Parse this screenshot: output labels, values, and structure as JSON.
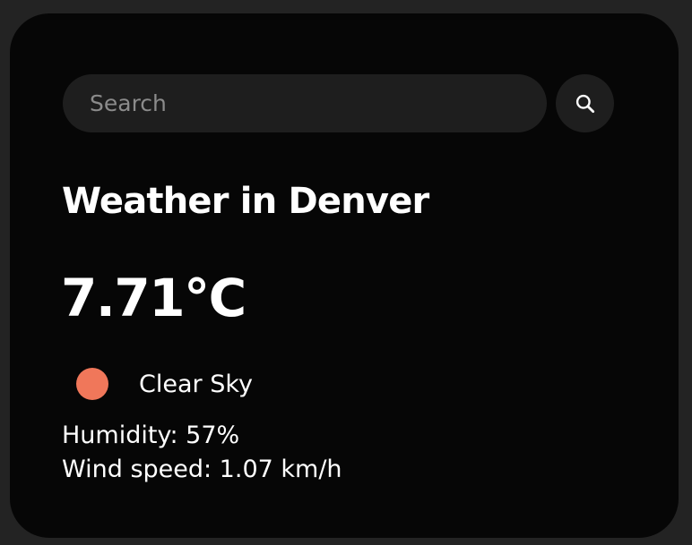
{
  "search": {
    "placeholder": "Search",
    "value": "",
    "button_icon": "search-icon"
  },
  "weather": {
    "title": "Weather in Denver",
    "temperature": "7.71°C",
    "condition": "Clear Sky",
    "condition_icon": "sun-circle-icon",
    "condition_color": "#f0775a",
    "humidity": "Humidity: 57%",
    "wind_speed": "Wind speed: 1.07 km/h"
  },
  "colors": {
    "page_background": "#232323",
    "card_background": "#060606",
    "input_background": "#1e1e1e",
    "text": "#ffffff"
  }
}
